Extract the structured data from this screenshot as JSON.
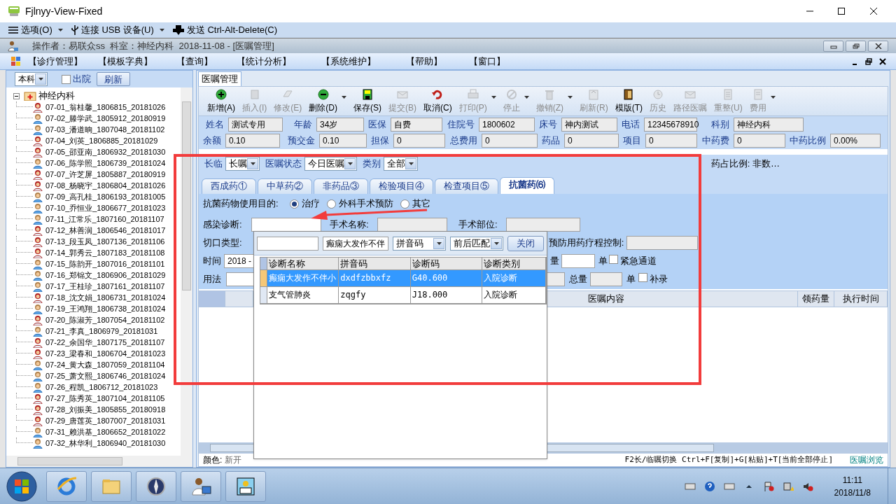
{
  "window": {
    "title": "Fjlnyy-View-Fixed"
  },
  "remote_menu": [
    {
      "label": "选项(O)",
      "dropdown": true
    },
    {
      "label": "连接 USB 设备(U)",
      "dropdown": true
    },
    {
      "label": "发送 Ctrl-Alt-Delete(C)",
      "dropdown": false
    }
  ],
  "app_header": {
    "text": "操作者：易联众ss  科室：神经内科  2018-11-08 - [医嘱管理]"
  },
  "menu": [
    "【诊疗管理】",
    "【模板字典】",
    "【查询】",
    "【统计分析】",
    "【系统维护】",
    "【帮助】",
    "【窗口】"
  ],
  "left_panel": {
    "dept_select": "本科",
    "discharged": {
      "label": "出院",
      "checked": false
    },
    "refresh": "刷新",
    "tree": {
      "label": "神经内科",
      "expanded": true,
      "children": [
        {
          "label": "07-01_翁桂馨_1806815_20181026",
          "kind": "female"
        },
        {
          "label": "07-02_滕学武_1805912_20180919",
          "kind": "male"
        },
        {
          "label": "07-03_潘道晌_1807048_20181102",
          "kind": "male"
        },
        {
          "label": "07-04_刘英_1806885_20181029",
          "kind": "female"
        },
        {
          "label": "07-05_邵亚南_1806932_20181030",
          "kind": "female"
        },
        {
          "label": "07-06_陈学照_1806739_20181024",
          "kind": "male"
        },
        {
          "label": "07-07_许芝屏_1805887_20180919",
          "kind": "female"
        },
        {
          "label": "07-08_杨晓宇_1806804_20181026",
          "kind": "female"
        },
        {
          "label": "07-09_高孔桂_1806193_20181005",
          "kind": "male"
        },
        {
          "label": "07-10_乔恒业_1806677_20181023",
          "kind": "male"
        },
        {
          "label": "07-11_江常乐_1807160_20181107",
          "kind": "male"
        },
        {
          "label": "07-12_林善润_1806546_20181017",
          "kind": "female"
        },
        {
          "label": "07-13_段玉凤_1807136_20181106",
          "kind": "female"
        },
        {
          "label": "07-14_郭秀云_1807183_20181108",
          "kind": "female"
        },
        {
          "label": "07-15_陈韵开_1807016_20181101",
          "kind": "male"
        },
        {
          "label": "07-16_郑锦文_1806906_20181029",
          "kind": "male"
        },
        {
          "label": "07-17_王桂珍_1807161_20181107",
          "kind": "male"
        },
        {
          "label": "07-18_沈文娟_1806731_20181024",
          "kind": "female"
        },
        {
          "label": "07-19_王鸿翔_1806738_20181024",
          "kind": "male"
        },
        {
          "label": "07-20_陈淑芳_1807054_20181102",
          "kind": "female"
        },
        {
          "label": "07-21_李真_1806979_20181031",
          "kind": "male"
        },
        {
          "label": "07-22_余国华_1807175_20181107",
          "kind": "female"
        },
        {
          "label": "07-23_梁春和_1806704_20181023",
          "kind": "female"
        },
        {
          "label": "07-24_黄大森_1807059_20181104",
          "kind": "male"
        },
        {
          "label": "07-25_萧文熙_1806746_20181024",
          "kind": "male"
        },
        {
          "label": "07-26_程凯_1806712_20181023",
          "kind": "male"
        },
        {
          "label": "07-27_陈秀英_1807104_20181105",
          "kind": "female"
        },
        {
          "label": "07-28_刘振美_1805855_20180918",
          "kind": "female"
        },
        {
          "label": "07-29_唐莲英_1807007_20181031",
          "kind": "female"
        },
        {
          "label": "07-31_赖洪基_1806652_20181022",
          "kind": "male"
        },
        {
          "label": "07-32_林华利_1806940_20181030",
          "kind": "male"
        }
      ]
    }
  },
  "main_tab": {
    "label": "医嘱管理"
  },
  "toolbar": [
    {
      "label": "新增(A)",
      "disabled": false,
      "dropdown": false
    },
    {
      "label": "插入(I)",
      "disabled": true,
      "dropdown": false
    },
    {
      "label": "修改(E)",
      "disabled": true,
      "dropdown": false
    },
    {
      "label": "删除(D)",
      "disabled": false,
      "dropdown": true
    },
    {
      "label": "保存(S)",
      "disabled": false,
      "dropdown": false
    },
    {
      "label": "提交(B)",
      "disabled": true,
      "dropdown": false
    },
    {
      "label": "取消(C)",
      "disabled": false,
      "dropdown": false
    },
    {
      "label": "打印(P)",
      "disabled": true,
      "dropdown": true
    },
    {
      "label": "停止",
      "disabled": true,
      "dropdown": true
    },
    {
      "label": "撤销(Z)",
      "disabled": true,
      "dropdown": true
    },
    {
      "label": "刷新(R)",
      "disabled": true,
      "dropdown": false
    },
    {
      "label": "模版(T)",
      "disabled": false,
      "dropdown": false
    },
    {
      "label": "历史",
      "disabled": true,
      "dropdown": false
    },
    {
      "label": "路径医嘱",
      "disabled": true,
      "dropdown": false
    },
    {
      "label": "重整(U)",
      "disabled": true,
      "dropdown": false
    },
    {
      "label": "费用",
      "disabled": true,
      "dropdown": true
    }
  ],
  "patient_info": [
    [
      {
        "label": "姓名",
        "value": "测试专用"
      },
      {
        "label": "年龄",
        "value": "34岁"
      },
      {
        "label": "医保",
        "value": "自费"
      },
      {
        "label": "住院号",
        "value": "1800602"
      },
      {
        "label": "床号",
        "value": "神内测试"
      },
      {
        "label": "电话",
        "value": "12345678910"
      },
      {
        "label": "科别",
        "value": "神经内科"
      }
    ],
    [
      {
        "label": "余额",
        "value": "0.10"
      },
      {
        "label": "预交金",
        "value": "0.10"
      },
      {
        "label": "担保",
        "value": "0"
      },
      {
        "label": "总费用",
        "value": "0"
      },
      {
        "label": "药品",
        "value": "0"
      },
      {
        "label": "项目",
        "value": "0"
      },
      {
        "label": "中药费",
        "value": "0"
      },
      {
        "label": "中药比例",
        "value": "0.00%"
      }
    ]
  ],
  "filters": [
    {
      "label": "长临",
      "value": "长嘱"
    },
    {
      "label": "医嘱状态",
      "value": "今日医嘱"
    },
    {
      "label": "类别",
      "value": "全部"
    }
  ],
  "drug_ratio": "药占比例: 非数…",
  "order_tabs": [
    {
      "label": "西成药①",
      "selected": false
    },
    {
      "label": "中草药②",
      "selected": false
    },
    {
      "label": "非药品③",
      "selected": false
    },
    {
      "label": "检验项目④",
      "selected": false
    },
    {
      "label": "检查项目⑤",
      "selected": false
    },
    {
      "label": "抗菌药⑹",
      "selected": true
    }
  ],
  "antibiotic_form": {
    "purpose_label": "抗菌药物使用目的:",
    "purposes": [
      {
        "label": "治疗",
        "selected": true
      },
      {
        "label": "外科手术预防",
        "selected": false
      },
      {
        "label": "其它",
        "selected": false
      }
    ],
    "infection_label": "感染诊断:",
    "surgery_name_label": "手术名称:",
    "surgery_site_label": "手术部位:",
    "incision_label": "切口类型:",
    "prophylaxis_label": "预防用药疗程控制:",
    "time_label": "时间",
    "time_value": "2018 -",
    "dose_label": "量",
    "unit_label": "单",
    "urgent": {
      "label": "紧急通道",
      "checked": false
    },
    "usage_label": "用法",
    "total_label": "总量",
    "unit_label_2": "单",
    "backfill": {
      "label": "补录",
      "checked": false
    }
  },
  "order_grid": {
    "columns": [
      "医嘱内容",
      "领药量",
      "执行时间"
    ]
  },
  "status_bar": {
    "color_label": "颜色:",
    "color_new": "新开",
    "shortcuts": "F2长/临嘱切换 Ctrl+F[复制]+G[粘贴]+T[当前全部停止]",
    "browse": "医嘱浏览"
  },
  "diagnosis_popup": {
    "name_value": "癫痫大发作不伴",
    "code_type": "拼音码",
    "match_mode": "前后匹配",
    "close": "关闭",
    "columns": [
      "诊断名称",
      "拼音码",
      "诊断码",
      "诊断类别"
    ],
    "rows": [
      {
        "cells": [
          "癫痫大发作不伴小",
          "dxdfzbbxfz",
          "G40.600",
          "入院诊断"
        ],
        "selected": true
      },
      {
        "cells": [
          "支气管肺炎",
          "zqgfy",
          "J18.000",
          "入院诊断"
        ],
        "selected": false
      }
    ]
  },
  "clock": {
    "time": "11:11",
    "date": "2018/11/8"
  }
}
